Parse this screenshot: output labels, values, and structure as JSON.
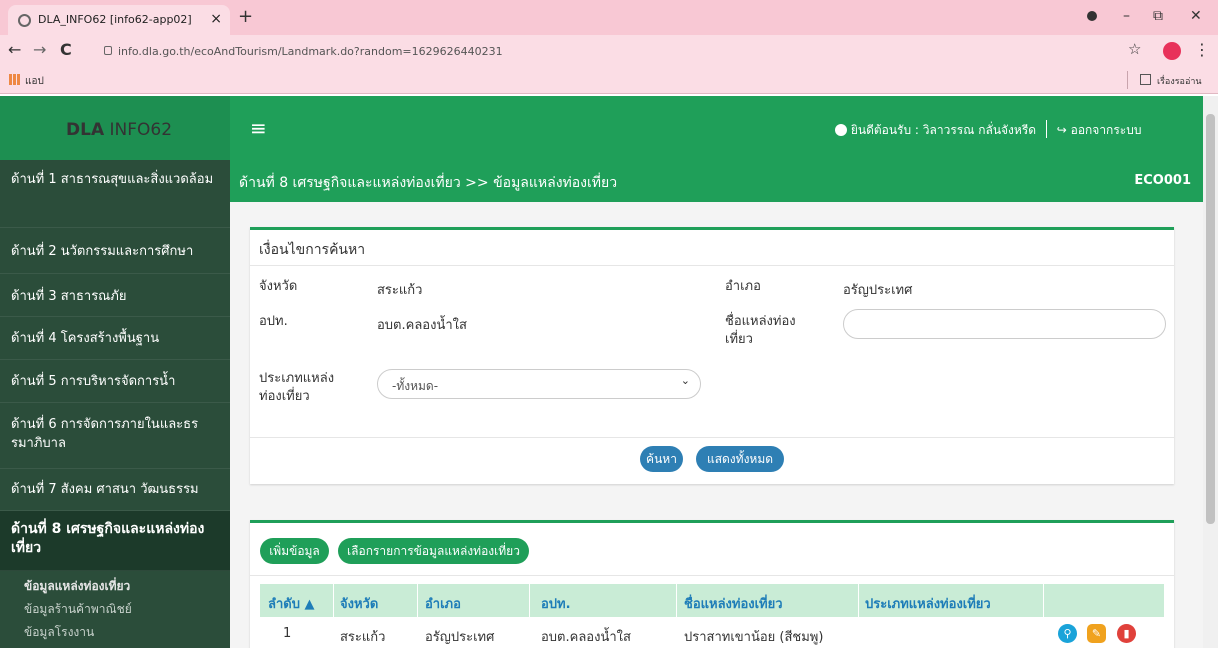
{
  "browser": {
    "tab_title": "DLA_INFO62 [info62-app02]",
    "tab_close": "×",
    "new_tab": "+",
    "back": "←",
    "forward": "→",
    "reload": "C",
    "url": "info.dla.go.th/ecoAndTourism/Landmark.do?random=1629626440231",
    "star": "☆",
    "menu": "⋮",
    "bookmark_apps": "แอป",
    "reading_list": "เรื่องรออ่าน",
    "minimize": "–",
    "restore": "⧉",
    "close": "✕"
  },
  "header": {
    "brand_bold": "DLA",
    "brand_rest": " INFO62",
    "menu_icon": "≡",
    "welcome": "ยินดีต้อนรับ : วิลาวรรณ กลั่นจังหรีด",
    "logout": "ออกจากระบบ"
  },
  "sidebar": {
    "items": [
      {
        "label": "ด้านที่ 1 สาธารณสุขและสิ่งแวดล้อม"
      },
      {
        "label": "ด้านที่ 2 นวัตกรรมและการศึกษา"
      },
      {
        "label": "ด้านที่ 3 สาธารณภัย"
      },
      {
        "label": "ด้านที่ 4 โครงสร้างพื้นฐาน"
      },
      {
        "label": "ด้านที่ 5 การบริหารจัดการน้ำ"
      },
      {
        "label": "ด้านที่ 6 การจัดการภายในและธรรมาภิบาล"
      },
      {
        "label": "ด้านที่ 7 สังคม ศาสนา วัฒนธรรม"
      },
      {
        "label": "ด้านที่ 8 เศรษฐกิจและแหล่งท่องเที่ยว"
      }
    ],
    "subitems": [
      {
        "label": "ข้อมูลแหล่งท่องเที่ยว"
      },
      {
        "label": "ข้อมูลร้านค้าพาณิชย์"
      },
      {
        "label": "ข้อมูลโรงงาน"
      }
    ]
  },
  "page": {
    "breadcrumb": "ด้านที่ 8 เศรษฐกิจและแหล่งท่องเที่ยว >>  ข้อมูลแหล่งท่องเที่ยว",
    "code": "ECO001"
  },
  "search": {
    "title": "เงื่อนไขการค้นหา",
    "province_label": "จังหวัด",
    "province_value": "สระแก้ว",
    "district_label": "อำเภอ",
    "district_value": "อรัญประเทศ",
    "lao_label": "อปท.",
    "lao_value": "อบต.คลองน้ำใส",
    "name_label_1": "ชื่อแหล่งท่อง",
    "name_label_2": "เที่ยว",
    "name_value": "",
    "type_label_1": "ประเภทแหล่ง",
    "type_label_2": "ท่องเที่ยว",
    "type_selected": "-ทั้งหมด-",
    "search_button": "ค้นหา",
    "show_all_button": "แสดงทั้งหมด"
  },
  "list": {
    "add_button": "เพิ่มข้อมูล",
    "select_button": "เลือกรายการข้อมูลแหล่งท่องเที่ยว",
    "columns": [
      "ลำดับ ▲",
      "จังหวัด",
      "อำเภอ",
      "อปท.",
      "ชื่อแหล่งท่องเที่ยว",
      "ประเภทแหล่งท่องเที่ยว"
    ],
    "rows": [
      {
        "no": "1",
        "province": "สระแก้ว",
        "district": "อรัญประเทศ",
        "lao": "อบต.คลองน้ำใส",
        "name": "ปราสาทเขาน้อย (สีชมพู)",
        "type": ""
      }
    ]
  }
}
